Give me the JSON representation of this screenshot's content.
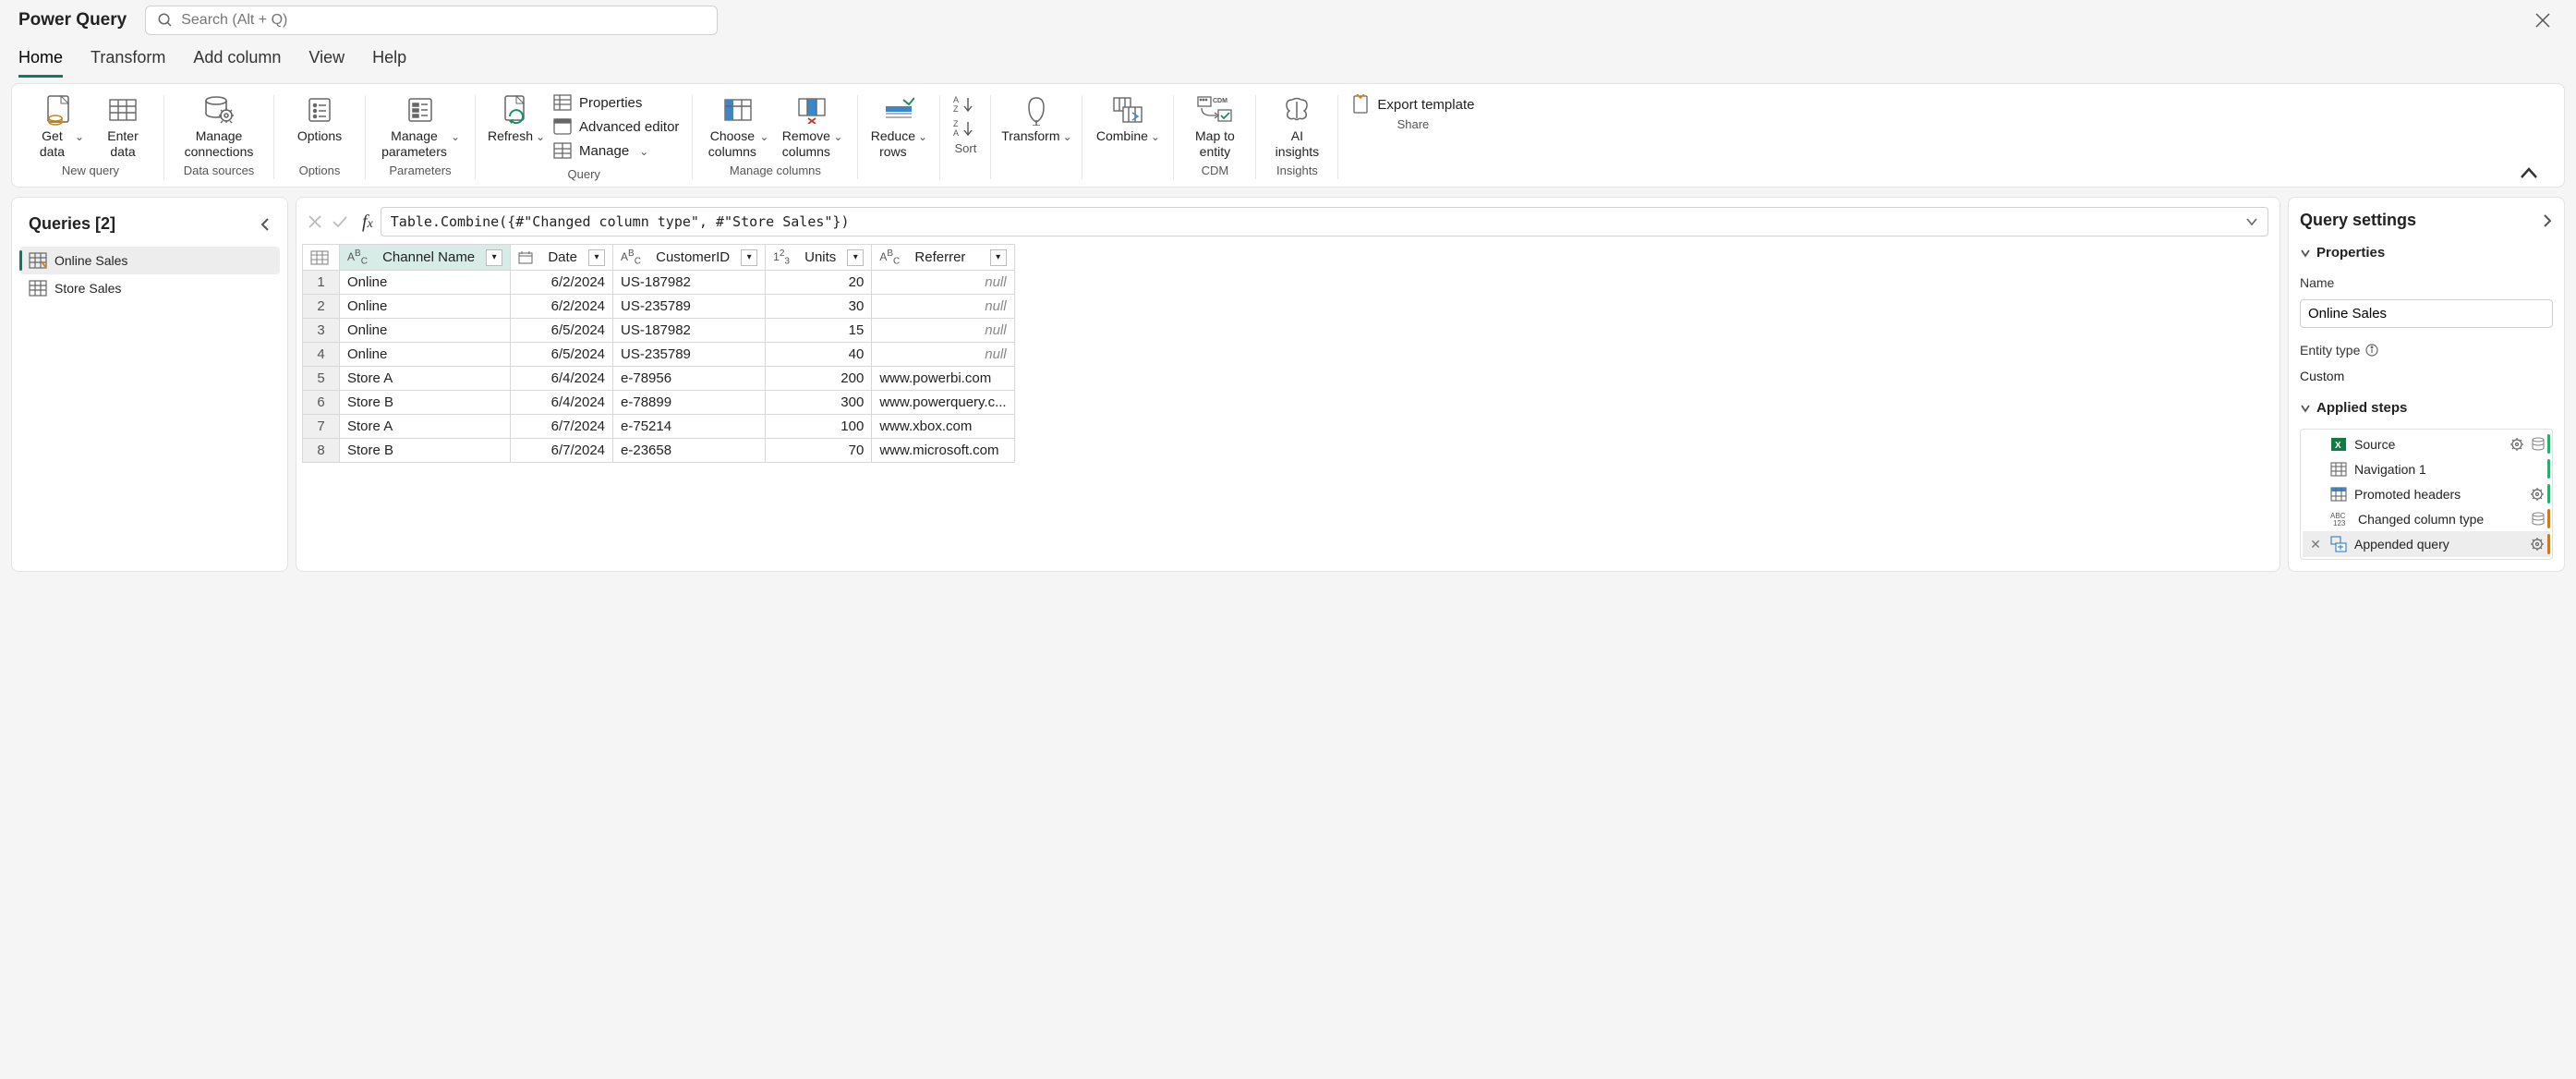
{
  "app_title": "Power Query",
  "search": {
    "placeholder": "Search (Alt + Q)"
  },
  "tabs": [
    "Home",
    "Transform",
    "Add column",
    "View",
    "Help"
  ],
  "ribbon": {
    "get_data": "Get data",
    "enter_data": "Enter data",
    "new_query": "New query",
    "manage_connections": "Manage connections",
    "data_sources": "Data sources",
    "options": "Options",
    "options_group": "Options",
    "manage_parameters": "Manage parameters",
    "parameters_group": "Parameters",
    "refresh": "Refresh",
    "properties": "Properties",
    "advanced_editor": "Advanced editor",
    "manage": "Manage",
    "query_group": "Query",
    "choose_columns": "Choose columns",
    "remove_columns": "Remove columns",
    "manage_columns_group": "Manage columns",
    "reduce_rows": "Reduce rows",
    "sort_group": "Sort",
    "transform": "Transform",
    "combine": "Combine",
    "map_to_entity": "Map to entity",
    "cdm_group": "CDM",
    "ai_insights": "AI insights",
    "insights_group": "Insights",
    "export_template": "Export template",
    "share_group": "Share"
  },
  "queries": {
    "title": "Queries [2]",
    "items": [
      "Online Sales",
      "Store Sales"
    ]
  },
  "formula": "Table.Combine({#\"Changed column type\", #\"Store Sales\"})",
  "table": {
    "columns": [
      "Channel Name",
      "Date",
      "CustomerID",
      "Units",
      "Referrer"
    ],
    "rows": [
      {
        "n": 1,
        "channel": "Online",
        "date": "6/2/2024",
        "cust": "US-187982",
        "units": 20,
        "ref": "null"
      },
      {
        "n": 2,
        "channel": "Online",
        "date": "6/2/2024",
        "cust": "US-235789",
        "units": 30,
        "ref": "null"
      },
      {
        "n": 3,
        "channel": "Online",
        "date": "6/5/2024",
        "cust": "US-187982",
        "units": 15,
        "ref": "null"
      },
      {
        "n": 4,
        "channel": "Online",
        "date": "6/5/2024",
        "cust": "US-235789",
        "units": 40,
        "ref": "null"
      },
      {
        "n": 5,
        "channel": "Store A",
        "date": "6/4/2024",
        "cust": "e-78956",
        "units": 200,
        "ref": "www.powerbi.com"
      },
      {
        "n": 6,
        "channel": "Store B",
        "date": "6/4/2024",
        "cust": "e-78899",
        "units": 300,
        "ref": "www.powerquery.c..."
      },
      {
        "n": 7,
        "channel": "Store A",
        "date": "6/7/2024",
        "cust": "e-75214",
        "units": 100,
        "ref": "www.xbox.com"
      },
      {
        "n": 8,
        "channel": "Store B",
        "date": "6/7/2024",
        "cust": "e-23658",
        "units": 70,
        "ref": "www.microsoft.com"
      }
    ]
  },
  "settings": {
    "title": "Query settings",
    "props_section": "Properties",
    "name_label": "Name",
    "name_value": "Online Sales",
    "entity_type_label": "Entity type",
    "entity_type_value": "Custom",
    "steps_section": "Applied steps",
    "steps": [
      {
        "name": "Source",
        "gear": true,
        "db": true,
        "color": "green"
      },
      {
        "name": "Navigation 1",
        "gear": false,
        "db": false,
        "color": "green"
      },
      {
        "name": "Promoted headers",
        "gear": true,
        "db": false,
        "color": "green"
      },
      {
        "name": "Changed column type",
        "gear": false,
        "db": true,
        "color": "orange"
      },
      {
        "name": "Appended query",
        "gear": true,
        "db": false,
        "color": "orange",
        "active": true
      }
    ]
  }
}
